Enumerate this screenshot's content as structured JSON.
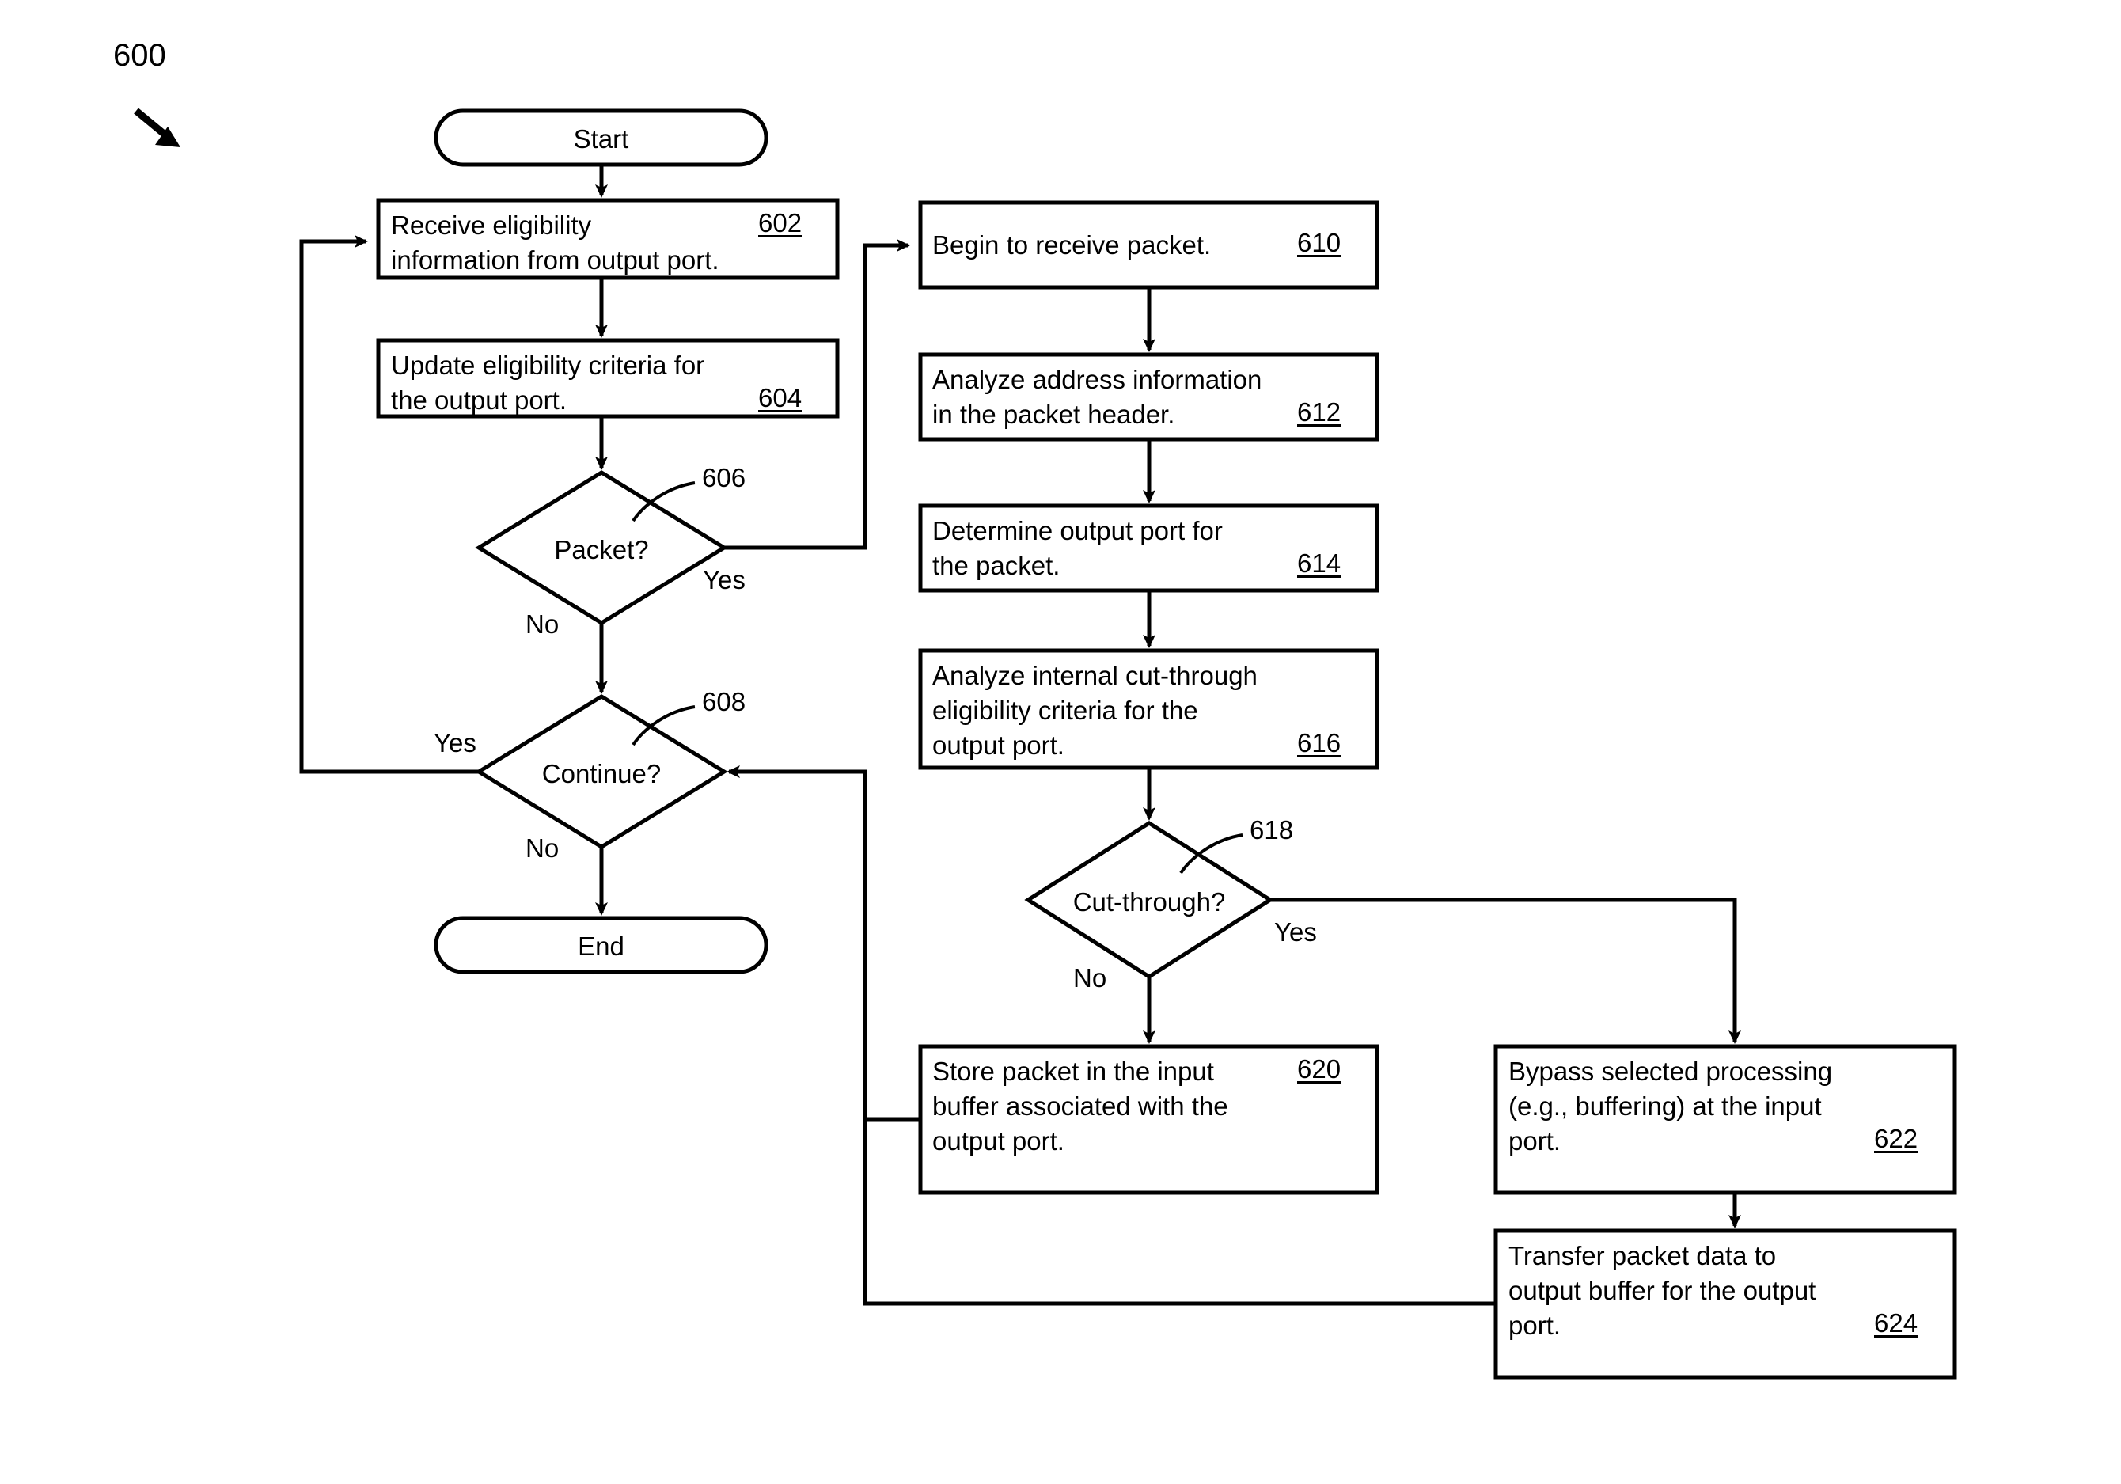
{
  "figure": {
    "number": "600",
    "arrow_icon": "figure-pointer-arrow-icon"
  },
  "terminators": {
    "start": "Start",
    "end": "End"
  },
  "process_nodes": [
    {
      "id": "602",
      "lines": [
        "Receive eligibility",
        "information from output port."
      ],
      "ref": "602"
    },
    {
      "id": "604",
      "lines": [
        "Update eligibility criteria for",
        "the output port."
      ],
      "ref": "604"
    },
    {
      "id": "610",
      "lines": [
        "Begin to receive packet."
      ],
      "ref": "610"
    },
    {
      "id": "612",
      "lines": [
        "Analyze address information",
        "in the packet header."
      ],
      "ref": "612"
    },
    {
      "id": "614",
      "lines": [
        "Determine output port for",
        "the packet."
      ],
      "ref": "614"
    },
    {
      "id": "616",
      "lines": [
        "Analyze internal cut-through",
        "eligibility criteria for the",
        "output port."
      ],
      "ref": "616"
    },
    {
      "id": "620",
      "lines": [
        "Store packet in the input",
        "buffer associated with the",
        "output port."
      ],
      "ref": "620"
    },
    {
      "id": "622",
      "lines": [
        "Bypass selected processing",
        "(e.g., buffering) at the input",
        "port."
      ],
      "ref": "622"
    },
    {
      "id": "624",
      "lines": [
        "Transfer packet data to",
        "output buffer for the output",
        "port."
      ],
      "ref": "624"
    }
  ],
  "decision_nodes": [
    {
      "id": "606",
      "label": "Packet?",
      "ref": "606",
      "yes": "Yes",
      "no": "No"
    },
    {
      "id": "608",
      "label": "Continue?",
      "ref": "608",
      "yes": "Yes",
      "no": "No"
    },
    {
      "id": "618",
      "label": "Cut-through?",
      "ref": "618",
      "yes": "Yes",
      "no": "No"
    }
  ],
  "colors": {
    "stroke": "#000000",
    "fill": "#ffffff",
    "background": "#ffffff"
  }
}
